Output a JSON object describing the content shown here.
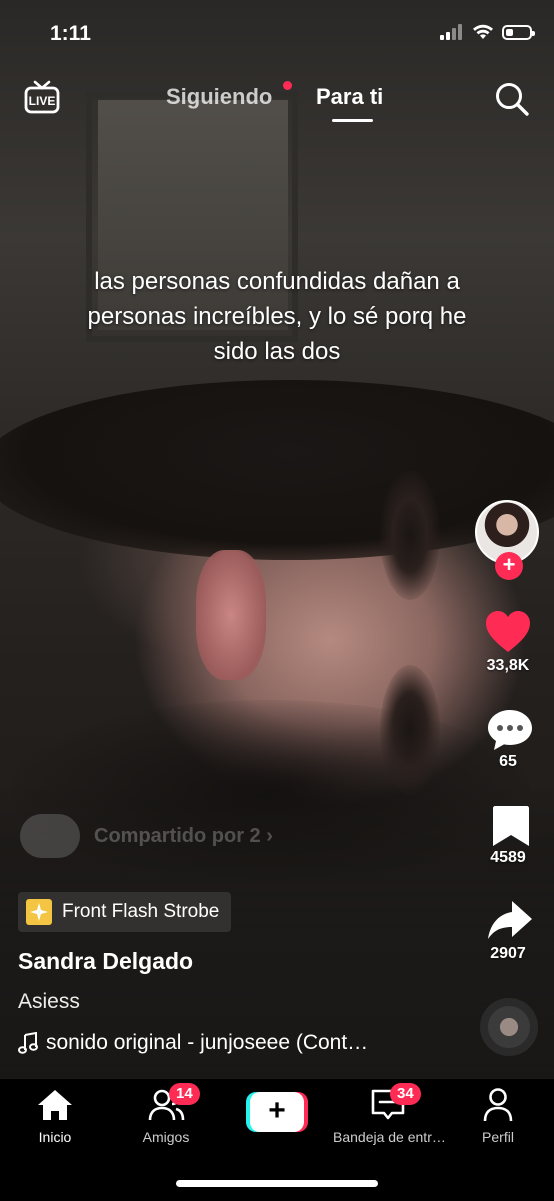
{
  "status_bar": {
    "time": "1:11"
  },
  "top_nav": {
    "live_label": "LIVE",
    "tabs": [
      {
        "label": "Siguiendo",
        "active": false,
        "has_dot": true
      },
      {
        "label": "Para ti",
        "active": true
      }
    ]
  },
  "video": {
    "caption": "las personas confundidas dañan a personas increíbles, y lo sé porq he sido las dos",
    "shared_by": "Compartido por 2 ›",
    "effect": "Front Flash Strobe",
    "username": "Sandra Delgado",
    "description": "Asiess",
    "sound": "sonido original - junjoseee (Cont…"
  },
  "actions": {
    "likes": "33,8K",
    "comments": "65",
    "saves": "4589",
    "shares": "2907"
  },
  "bottom_nav": {
    "items": [
      {
        "label": "Inicio",
        "active": true
      },
      {
        "label": "Amigos",
        "badge": "14"
      },
      {
        "label": ""
      },
      {
        "label": "Bandeja de entr…",
        "badge": "34"
      },
      {
        "label": "Perfil"
      }
    ],
    "create_symbol": "+"
  },
  "colors": {
    "accent": "#fe2c55",
    "cyan": "#25f4ee"
  }
}
